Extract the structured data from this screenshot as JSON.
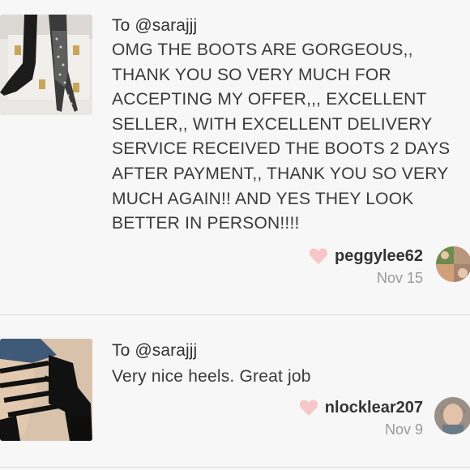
{
  "reviews": [
    {
      "to": "To @sarajjj",
      "text": "OMG THE BOOTS ARE GORGEOUS,, THANK YOU SO VERY MUCH FOR ACCEPTING MY OFFER,,, EXCELLENT SELLER,, WITH EXCELLENT DELIVERY SERVICE RECEIVED THE BOOTS 2 DAYS AFTER PAYMENT,, THANK YOU SO VERY MUCH AGAIN!! AND YES THEY LOOK BETTER IN PERSON!!!!",
      "username": "peggylee62",
      "date": "Nov 15",
      "thumb_icon": "rhinestone-boot-photo",
      "avatar_icon": "user-avatar-photo"
    },
    {
      "to": "To @sarajjj",
      "text": "Very nice heels. Great job",
      "username": "nlocklear207",
      "date": "Nov 9",
      "thumb_icon": "strappy-heels-photo",
      "avatar_icon": "user-avatar-photo"
    }
  ],
  "colors": {
    "background": "#f7f7f7",
    "heart": "#f7c6c9",
    "divider": "#dcdcdc",
    "date": "#999999"
  }
}
